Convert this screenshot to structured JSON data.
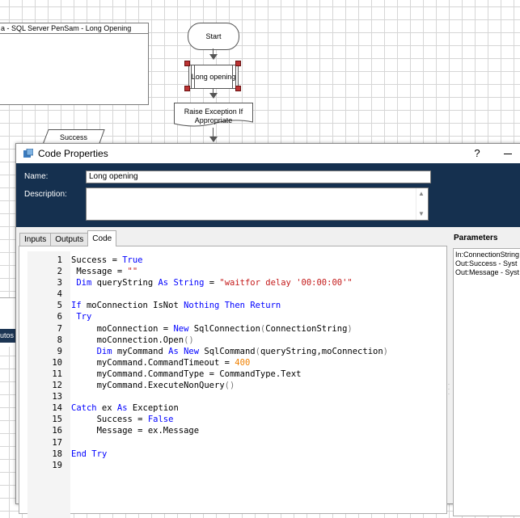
{
  "flowchart": {
    "subwindow_title": "a - SQL Server PenSam - Long Opening",
    "start_label": "Start",
    "code_stage_label": "Long opening",
    "raise_label": "Raise Exception If Appropriate",
    "success_label": "Success",
    "left_tab_label": "utos"
  },
  "dialog": {
    "title": "Code Properties",
    "help_label": "?",
    "name_label": "Name:",
    "name_value": "Long opening",
    "description_label": "Description:",
    "description_value": "",
    "tabs": [
      {
        "label": "Inputs",
        "active": false
      },
      {
        "label": "Outputs",
        "active": false
      },
      {
        "label": "Code",
        "active": true
      }
    ],
    "parameters_title": "Parameters",
    "parameters": [
      "In:ConnectionString",
      "Out:Success - Syst",
      "Out:Message - Syst"
    ]
  },
  "code": {
    "line_numbers": [
      "1",
      "2",
      "3",
      "4",
      "5",
      "6",
      "7",
      "8",
      "9",
      "10",
      "11",
      "12",
      "13",
      "14",
      "15",
      "16",
      "17",
      "18",
      "19"
    ],
    "lines": [
      [
        {
          "t": "Success = "
        },
        {
          "t": "True",
          "c": "kw"
        }
      ],
      [
        {
          "t": " Message = "
        },
        {
          "t": "\"\"",
          "c": "str"
        }
      ],
      [
        {
          "t": " "
        },
        {
          "t": "Dim",
          "c": "kw"
        },
        {
          "t": " queryString "
        },
        {
          "t": "As",
          "c": "kw"
        },
        {
          "t": " "
        },
        {
          "t": "String",
          "c": "kw"
        },
        {
          "t": " = "
        },
        {
          "t": "\"waitfor delay '00:00:00'\"",
          "c": "str"
        }
      ],
      [],
      [
        {
          "t": "If",
          "c": "kw"
        },
        {
          "t": " moConnection IsNot "
        },
        {
          "t": "Nothing",
          "c": "kw"
        },
        {
          "t": " "
        },
        {
          "t": "Then",
          "c": "kw"
        },
        {
          "t": " "
        },
        {
          "t": "Return",
          "c": "kw"
        }
      ],
      [
        {
          "t": " "
        },
        {
          "t": "Try",
          "c": "kw"
        }
      ],
      [
        {
          "t": "     moConnection = "
        },
        {
          "t": "New",
          "c": "kw"
        },
        {
          "t": " SqlConnection"
        },
        {
          "t": "(",
          "c": "fn"
        },
        {
          "t": "ConnectionString"
        },
        {
          "t": ")",
          "c": "fn"
        }
      ],
      [
        {
          "t": "     moConnection.Open"
        },
        {
          "t": "()",
          "c": "fn"
        }
      ],
      [
        {
          "t": "     "
        },
        {
          "t": "Dim",
          "c": "kw"
        },
        {
          "t": " myCommand "
        },
        {
          "t": "As",
          "c": "kw"
        },
        {
          "t": " "
        },
        {
          "t": "New",
          "c": "kw"
        },
        {
          "t": " SqlCommand"
        },
        {
          "t": "(",
          "c": "fn"
        },
        {
          "t": "queryString,moConnection"
        },
        {
          "t": ")",
          "c": "fn"
        }
      ],
      [
        {
          "t": "     myCommand.CommandTimeout = "
        },
        {
          "t": "400",
          "c": "num"
        }
      ],
      [
        {
          "t": "     myCommand.CommandType = CommandType.Text"
        }
      ],
      [
        {
          "t": "     myCommand.ExecuteNonQuery"
        },
        {
          "t": "()",
          "c": "fn"
        }
      ],
      [],
      [
        {
          "t": "Catch",
          "c": "kw"
        },
        {
          "t": " ex "
        },
        {
          "t": "As",
          "c": "kw"
        },
        {
          "t": " Exception"
        }
      ],
      [
        {
          "t": "     Success = "
        },
        {
          "t": "False",
          "c": "kw"
        }
      ],
      [
        {
          "t": "     Message = ex.Message"
        }
      ],
      [],
      [
        {
          "t": "End",
          "c": "kw"
        },
        {
          "t": " "
        },
        {
          "t": "Try",
          "c": "kw"
        }
      ],
      []
    ]
  }
}
